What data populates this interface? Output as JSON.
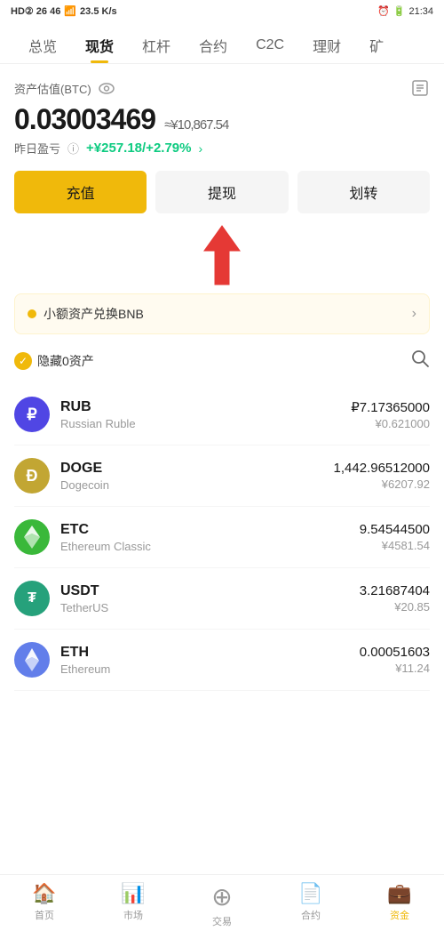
{
  "statusBar": {
    "left": "HD② 26 46",
    "wifi": "WiFi",
    "speed": "23.5 K/s",
    "time": "21:34",
    "battery": "20"
  },
  "nav": {
    "items": [
      {
        "label": "总览",
        "active": false
      },
      {
        "label": "现货",
        "active": true
      },
      {
        "label": "杠杆",
        "active": false
      },
      {
        "label": "合约",
        "active": false
      },
      {
        "label": "C2C",
        "active": false
      },
      {
        "label": "理财",
        "active": false
      },
      {
        "label": "矿",
        "active": false
      }
    ]
  },
  "asset": {
    "label": "资产估值(BTC)",
    "btcValue": "0.03003469",
    "cnyApprox": "≈¥10,867.54",
    "pnlLabel": "昨日盈亏",
    "pnlValue": "+¥257.18/+2.79%"
  },
  "buttons": {
    "deposit": "充值",
    "withdraw": "提现",
    "transfer": "划转"
  },
  "swapBanner": {
    "text": "小额资产兑换BNB"
  },
  "assetList": {
    "hideLabel": "隐藏0资产",
    "coins": [
      {
        "symbol": "RUB",
        "name": "Russian Ruble",
        "amount": "₽7.17365000",
        "cny": "¥0.621000",
        "iconType": "rub"
      },
      {
        "symbol": "DOGE",
        "name": "Dogecoin",
        "amount": "1,442.96512000",
        "cny": "¥6207.92",
        "iconType": "doge"
      },
      {
        "symbol": "ETC",
        "name": "Ethereum Classic",
        "amount": "9.54544500",
        "cny": "¥4581.54",
        "iconType": "etc"
      },
      {
        "symbol": "USDT",
        "name": "TetherUS",
        "amount": "3.21687404",
        "cny": "¥20.85",
        "iconType": "usdt"
      },
      {
        "symbol": "ETH",
        "name": "Ethereum",
        "amount": "0.00051603",
        "cny": "¥11.24",
        "iconType": "eth"
      }
    ]
  },
  "bottomNav": {
    "items": [
      {
        "label": "首页",
        "icon": "🏠",
        "active": false
      },
      {
        "label": "市场",
        "icon": "📊",
        "active": false
      },
      {
        "label": "交易",
        "icon": "🔄",
        "active": false
      },
      {
        "label": "合约",
        "icon": "📄",
        "active": false
      },
      {
        "label": "资金",
        "icon": "💼",
        "active": true
      }
    ]
  }
}
